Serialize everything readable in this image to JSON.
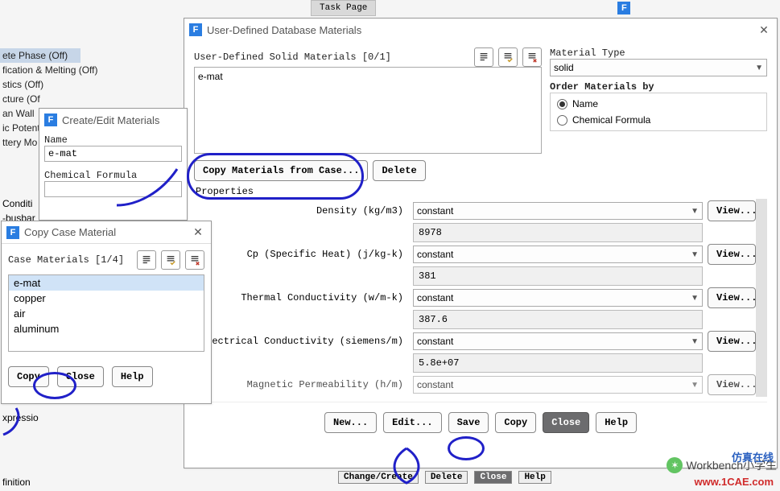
{
  "tabstrip": {
    "tab1": "Task Page"
  },
  "tree": {
    "items_top": [
      "ete Phase (Off)",
      "fication & Melting (Off)",
      "stics (Off)",
      "cture (Of",
      "an Wall",
      "ic Potent",
      "ttery Mo"
    ],
    "item_sel_idx": 0,
    "conditi": "Conditi",
    "busbar": "-busbar",
    "xpressi": "xpressio",
    "finition": "finition"
  },
  "cem": {
    "title": "Create/Edit Materials",
    "name_label": "Name",
    "name_value": "e-mat",
    "chem_label": "Chemical Formula"
  },
  "ccm": {
    "title": "Copy Case Material",
    "header": "Case Materials [1/4]",
    "items": [
      "e-mat",
      "copper",
      "air",
      "aluminum"
    ],
    "copy": "Copy",
    "close": "Close",
    "help": "Help"
  },
  "uddm": {
    "title": "User-Defined Database Materials",
    "list_header": "User-Defined Solid Materials [0/1]",
    "list_item": "e-mat",
    "mat_type_label": "Material Type",
    "mat_type_value": "solid",
    "order_by_label": "Order Materials by",
    "order_name": "Name",
    "order_chem": "Chemical Formula",
    "copy_from": "Copy Materials from Case...",
    "delete": "Delete",
    "properties_label": "Properties",
    "props": [
      {
        "label": "Density (kg/m3)",
        "mode": "constant",
        "value": "8978"
      },
      {
        "label": "Cp (Specific Heat) (j/kg-k)",
        "mode": "constant",
        "value": "381"
      },
      {
        "label": "Thermal Conductivity (w/m-k)",
        "mode": "constant",
        "value": "387.6"
      },
      {
        "label": "Electrical Conductivity (siemens/m)",
        "mode": "constant",
        "value": "5.8e+07"
      },
      {
        "label": "Magnetic Permeability (h/m)",
        "mode": "constant",
        "value": ""
      }
    ],
    "view": "View...",
    "footer": {
      "new": "New...",
      "edit": "Edit...",
      "save": "Save",
      "copy": "Copy",
      "close": "Close",
      "help": "Help"
    }
  },
  "parent_footer": {
    "change": "Change/Create",
    "delete": "Delete",
    "close": "Close",
    "help": "Help"
  },
  "watermark": {
    "name": "Workbench小学生",
    "brand": "仿真在线",
    "link": "www.1CAE.com"
  }
}
